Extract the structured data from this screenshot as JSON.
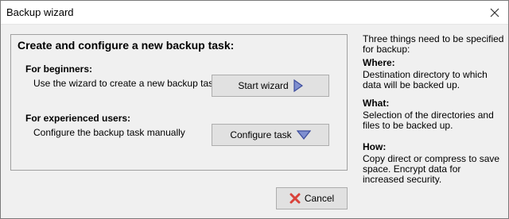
{
  "window": {
    "title": "Backup wizard"
  },
  "main": {
    "heading": "Create and configure a new backup task:",
    "beginners": {
      "label": "For beginners:",
      "description": "Use the wizard to create a new backup task",
      "button_label": "Start wizard"
    },
    "experienced": {
      "label": "For experienced users:",
      "description": "Configure the backup task manually",
      "button_label": "Configure task"
    }
  },
  "side": {
    "intro": "Three things need to be specified for backup:",
    "where_label": "Where:",
    "where_text": "Destination directory to which data will be backed up.",
    "what_label": "What:",
    "what_text": "Selection of the directories and files to be backed up.",
    "how_label": "How:",
    "how_text": "Copy direct or compress to save space. Encrypt data for increased security."
  },
  "footer": {
    "cancel_label": "Cancel"
  },
  "icons": {
    "close": "close-icon",
    "start": "triangle-right-icon",
    "configure": "triangle-down-icon",
    "cancel": "red-x-icon"
  },
  "colors": {
    "accent": "#3c4c9c",
    "cancel_icon": "#d9423a"
  }
}
